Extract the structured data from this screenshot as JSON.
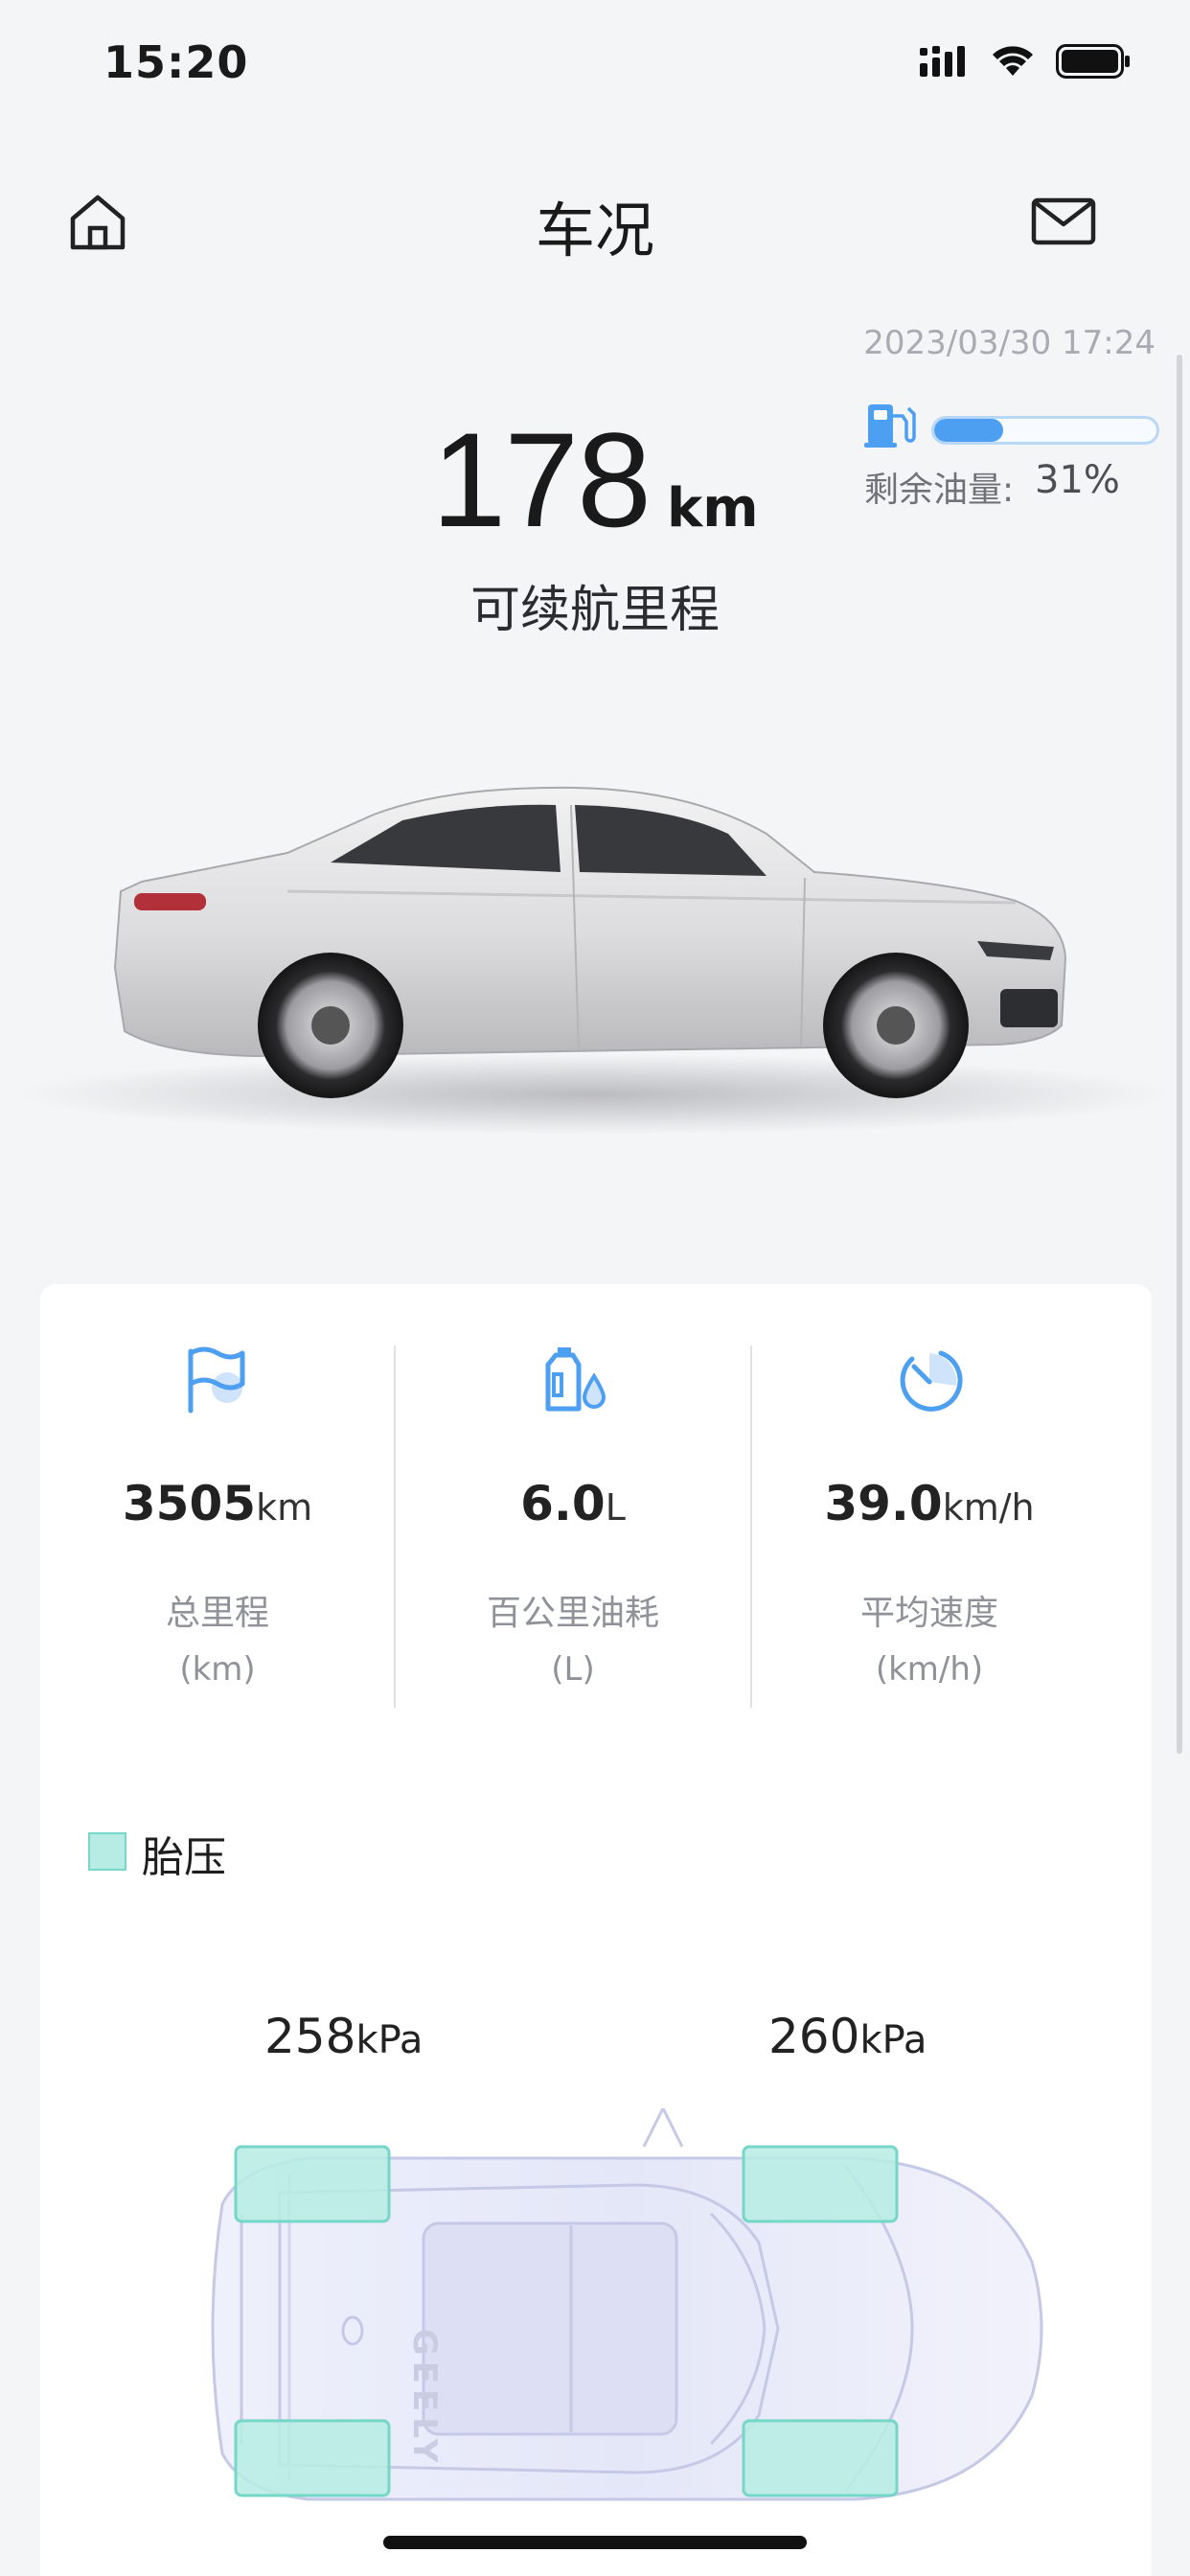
{
  "status_bar": {
    "time": "15:20",
    "icons": [
      "cellular-signal-icon",
      "wifi-icon",
      "battery-icon"
    ]
  },
  "nav": {
    "title": "车况",
    "left_icon": "home-icon",
    "right_icon": "mail-icon"
  },
  "header": {
    "timestamp": "2023/03/30 17:24",
    "fuel": {
      "label": "剩余油量:",
      "value": "31%",
      "fraction": 0.31,
      "icon": "fuel-pump-icon",
      "color": "#4d9ff1"
    },
    "range": {
      "value": "178",
      "unit": "km",
      "label": "可续航里程"
    }
  },
  "stats": [
    {
      "icon": "flag-icon",
      "value": "3505",
      "unit": "km",
      "label": "总里程",
      "sublabel": "(km)"
    },
    {
      "icon": "oil-can-icon",
      "value": "6.0",
      "unit": "L",
      "label": "百公里油耗",
      "sublabel": "(L)"
    },
    {
      "icon": "speedometer-icon",
      "value": "39.0",
      "unit": "km/h",
      "label": "平均速度",
      "sublabel": "(km/h)"
    }
  ],
  "tire_pressure": {
    "title": "胎压",
    "front_left": {
      "value": "258",
      "unit": "kPa"
    },
    "front_right": {
      "value": "260",
      "unit": "kPa"
    },
    "brand_text": "GEELY",
    "color": "#b6ece3"
  }
}
